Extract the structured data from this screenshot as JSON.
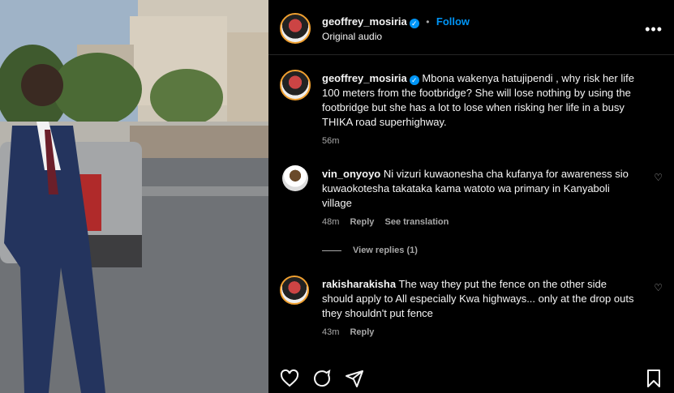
{
  "header": {
    "username": "geoffrey_mosiria",
    "verified_icon": "verified-badge-icon",
    "follow_label": "Follow",
    "separator": "•",
    "audio": "Original audio",
    "more_icon": "more-options-icon"
  },
  "caption": {
    "username": "geoffrey_mosiria",
    "text": "Mbona wakenya hatujipendi , why risk her life 100 meters from the footbridge? She will lose nothing by using the footbridge but she has a lot to lose when risking her life in a busy THIKA road superhighway.",
    "time": "56m"
  },
  "comments": [
    {
      "username": "vin_onyoyo",
      "text": "Ni vizuri kuwaonesha cha kufanya for awareness sio kuwaokotesha takataka kama watoto wa primary in Kanyaboli village",
      "time": "48m",
      "reply": "Reply",
      "translate": "See translation",
      "view_replies": "View replies (1)"
    },
    {
      "username": "rakisharakisha",
      "text": "The way they put the fence on the other side should apply to All especially Kwa highways... only at the drop outs they shouldn't put fence",
      "time": "43m",
      "reply": "Reply"
    }
  ],
  "actions": {
    "like_icon": "heart-icon",
    "comment_icon": "comment-icon",
    "share_icon": "share-icon",
    "save_icon": "bookmark-icon"
  }
}
